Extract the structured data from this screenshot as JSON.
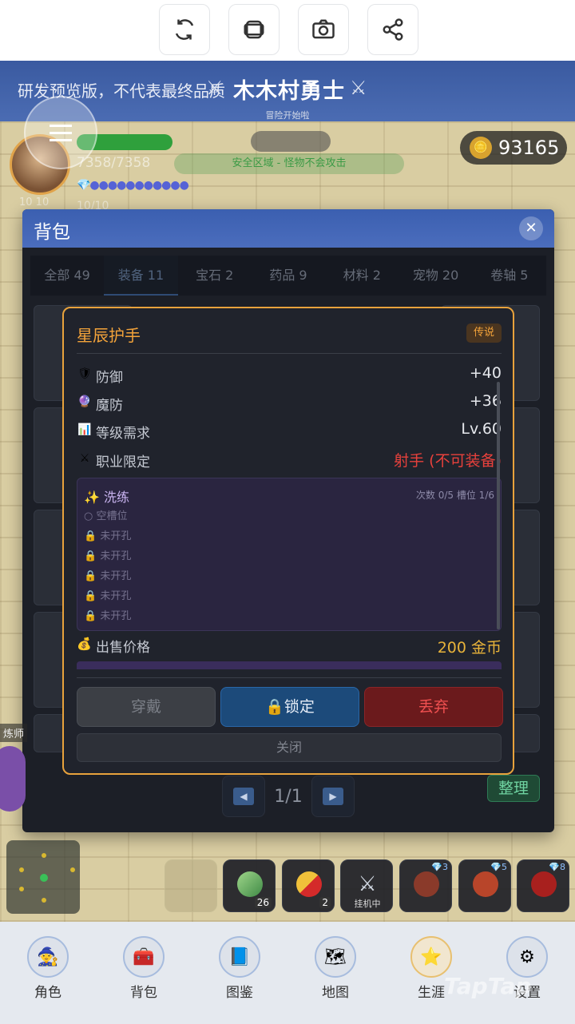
{
  "toolbar": {
    "buttons": [
      {
        "name": "refresh-button",
        "icon": "refresh-icon"
      },
      {
        "name": "window-button",
        "icon": "layers-icon"
      },
      {
        "name": "screenshot-button",
        "icon": "camera-icon"
      },
      {
        "name": "share-button",
        "icon": "share-icon"
      }
    ]
  },
  "header": {
    "dev_notice": "研发预览版，不代表最终品质",
    "title": "木木村勇士",
    "subtitle": "冒险开始啦"
  },
  "player": {
    "hp_text": "7358/7358",
    "level_text": "10/10",
    "level_small": "10 10",
    "mp_dots": "💎●●●●●●●●●●●"
  },
  "zone": {
    "safe_text": "安全区域 - 怪物不会攻击"
  },
  "coins": {
    "icon": "🪙",
    "value": "93165"
  },
  "bag": {
    "title": "背包",
    "close_icon": "✕",
    "tabs": [
      {
        "label": "全部 49"
      },
      {
        "label": "装备 11"
      },
      {
        "label": "宝石 2"
      },
      {
        "label": "药品 9"
      },
      {
        "label": "材料 2"
      },
      {
        "label": "宠物 20"
      },
      {
        "label": "卷轴 5"
      }
    ],
    "page_text": "1/1",
    "prev_icon": "◀",
    "next_icon": "▶",
    "sort_label": "整理"
  },
  "item": {
    "name": "星辰护手",
    "rarity": "传说",
    "stats": [
      {
        "icon": "🛡",
        "label": "防御",
        "value": "+40"
      },
      {
        "icon": "🔮",
        "label": "魔防",
        "value": "+36"
      },
      {
        "icon": "📊",
        "label": "等级需求",
        "value": "Lv.60"
      },
      {
        "icon": "⚔",
        "label": "职业限定",
        "value": "射手 (不可装备)"
      }
    ],
    "refine": {
      "title": "✨ 洗练",
      "meta": "次数 0/5  槽位 1/6",
      "slots": [
        "○ 空槽位",
        "🔒 未开孔",
        "🔒 未开孔",
        "🔒 未开孔",
        "🔒 未开孔",
        "🔒 未开孔"
      ]
    },
    "sell": {
      "icon": "💰",
      "label": "出售价格",
      "value": "200 金币"
    },
    "actions": {
      "wear": "穿戴",
      "lock": "🔒锁定",
      "drop": "丢弃",
      "close": "关闭"
    }
  },
  "hud": {
    "npc_label": "炼师",
    "quick_slots": [
      {
        "count": "",
        "label": "",
        "badge": ""
      },
      {
        "count": "26",
        "label": "",
        "badge": ""
      },
      {
        "count": "2",
        "label": "",
        "badge": ""
      },
      {
        "count": "",
        "label": "挂机中",
        "badge": ""
      },
      {
        "count": "",
        "label": "",
        "badge": "💎3"
      },
      {
        "count": "",
        "label": "",
        "badge": "💎5"
      },
      {
        "count": "",
        "label": "",
        "badge": "💎8"
      }
    ]
  },
  "nav": {
    "items": [
      {
        "label": "角色",
        "icon": "🧙"
      },
      {
        "label": "背包",
        "icon": "🧰"
      },
      {
        "label": "图鉴",
        "icon": "📘"
      },
      {
        "label": "地图",
        "icon": "🗺"
      },
      {
        "label": "生涯",
        "icon": "⭐"
      },
      {
        "label": "设置",
        "icon": "⚙"
      }
    ]
  },
  "watermark": "TapTap"
}
